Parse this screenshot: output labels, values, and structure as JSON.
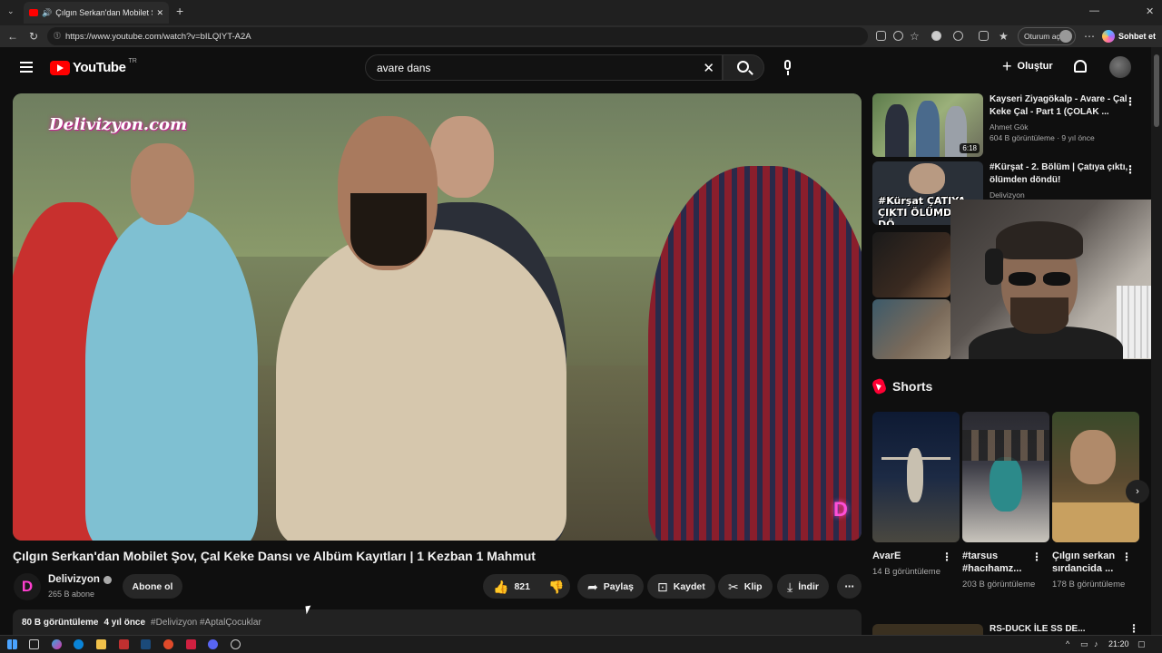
{
  "browser": {
    "tab_title": "Çılgın Serkan'dan Mobilet Şov",
    "url": "https://www.youtube.com/watch?v=bILQIYT-A2A",
    "signin_label": "Oturum aç",
    "chat_label": "Sohbet et"
  },
  "youtube": {
    "logo_text": "YouTube",
    "logo_region": "TR",
    "search_value": "avare dans",
    "create_label": "Oluştur"
  },
  "video": {
    "watermark": "Delivizyon.com",
    "corner_logo": "D",
    "title": "Çılgın Serkan'dan Mobilet Şov, Çal Keke Dansı ve Albüm Kayıtları | 1 Kezban 1 Mahmut",
    "channel_avatar_letter": "D",
    "channel_name": "Delivizyon",
    "subscribers": "265 B abone",
    "subscribe_label": "Abone ol",
    "like_count": "821",
    "share_label": "Paylaş",
    "save_label": "Kaydet",
    "clip_label": "Klip",
    "download_label": "İndir",
    "views": "80 B görüntüleme",
    "age": "4 yıl önce",
    "hashtags": "#Delivizyon #AptalÇocuklar"
  },
  "recommendations": [
    {
      "title": "Kayseri Ziyagökalp - Avare - Çal Keke Çal - Part 1 (ÇOLAK ...",
      "channel": "Ahmet Gök",
      "meta": "604 B görüntüleme · 9 yıl önce",
      "duration": "6:18"
    },
    {
      "title": "#Kürşat - 2. Bölüm | Çatıya çıktı, ölümden döndü!",
      "channel": "Delivizyon",
      "thumb_text": "#Kürşat ÇATIYA ÇIKTI ÖLÜMDEN DÖ"
    }
  ],
  "shorts": {
    "heading": "Shorts",
    "items": [
      {
        "title": "AvarE",
        "meta": "14 B görüntüleme"
      },
      {
        "title": "#tarsus #hacıhamz...",
        "meta": "203 B görüntüleme"
      },
      {
        "title": "Çılgın serkan sırdancida ...",
        "meta": "178 B görüntüleme"
      }
    ]
  },
  "bottom_rec": {
    "title": "RS-DUCK İLE SS DE..."
  },
  "taskbar": {
    "time": "21:20"
  },
  "colors": {
    "accent_red": "#ff0000",
    "bg": "#0f0f0f",
    "pill": "#272727",
    "brand_pink": "#ff3fd0"
  }
}
